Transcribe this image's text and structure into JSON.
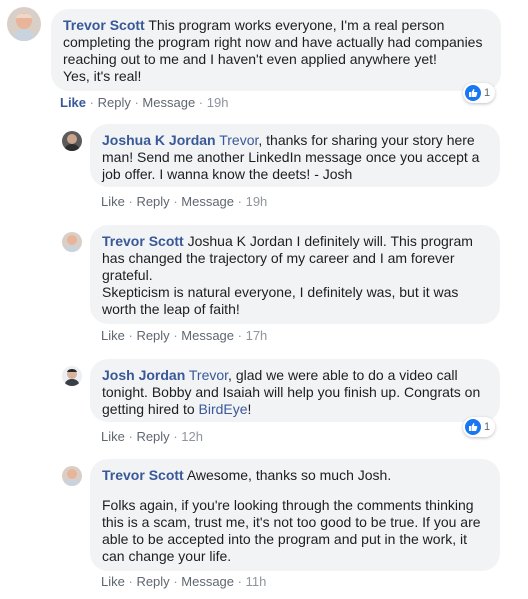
{
  "comments": [
    {
      "author": "Trevor Scott",
      "text_lines": [
        "This program works everyone, I'm a real person",
        "completing the program right now and have actually had companies",
        "reaching out to me and I haven't even applied anywhere yet!",
        "Yes, it's real!"
      ],
      "actions": {
        "like": "Like",
        "reply": "Reply",
        "message": "Message",
        "time": "19h"
      },
      "reaction_count": "1"
    },
    {
      "author": "Joshua K Jordan",
      "mention": "Trevor",
      "text_lines": [
        ", thanks for sharing your story here",
        "man! Send me another LinkedIn message once you accept a",
        "job offer. I wanna know the deets! - Josh"
      ],
      "actions": {
        "like": "Like",
        "reply": "Reply",
        "message": "Message",
        "time": "19h"
      }
    },
    {
      "author": "Trevor Scott",
      "text_lines": [
        "Joshua K Jordan I definitely will. This program",
        "has changed the trajectory of my career and I am forever",
        "grateful.",
        "Skepticism is natural everyone, I definitely was, but it was",
        "worth the leap of faith!"
      ],
      "actions": {
        "like": "Like",
        "reply": "Reply",
        "message": "Message",
        "time": "17h"
      }
    },
    {
      "author": "Josh Jordan",
      "mention": "Trevor",
      "text_lines": [
        ", glad we were able to do a video call",
        "tonight. Bobby and Isaiah will help you finish up. Congrats on",
        "getting hired to "
      ],
      "link": "BirdEye",
      "trail": "!",
      "actions": {
        "like": "Like",
        "reply": "Reply",
        "time": "12h"
      },
      "reaction_count": "1"
    },
    {
      "author": "Trevor Scott",
      "text_lines": [
        "Awesome, thanks so much Josh.",
        "Folks again, if you're looking through the comments thinking",
        "this is a scam, trust me, it's not too good to be true. If you are",
        "able to be accepted into the program and put in the work, it",
        "can change your life."
      ],
      "actions": {
        "like": "Like",
        "reply": "Reply",
        "message": "Message",
        "time": "11h"
      }
    }
  ],
  "colors": {
    "bubble": "#f2f3f5",
    "name": "#385898",
    "meta": "#90949c",
    "like_blue": "#1877f2"
  },
  "icons": {
    "avatar": "user-avatar",
    "reaction": "thumbs-up-icon"
  }
}
